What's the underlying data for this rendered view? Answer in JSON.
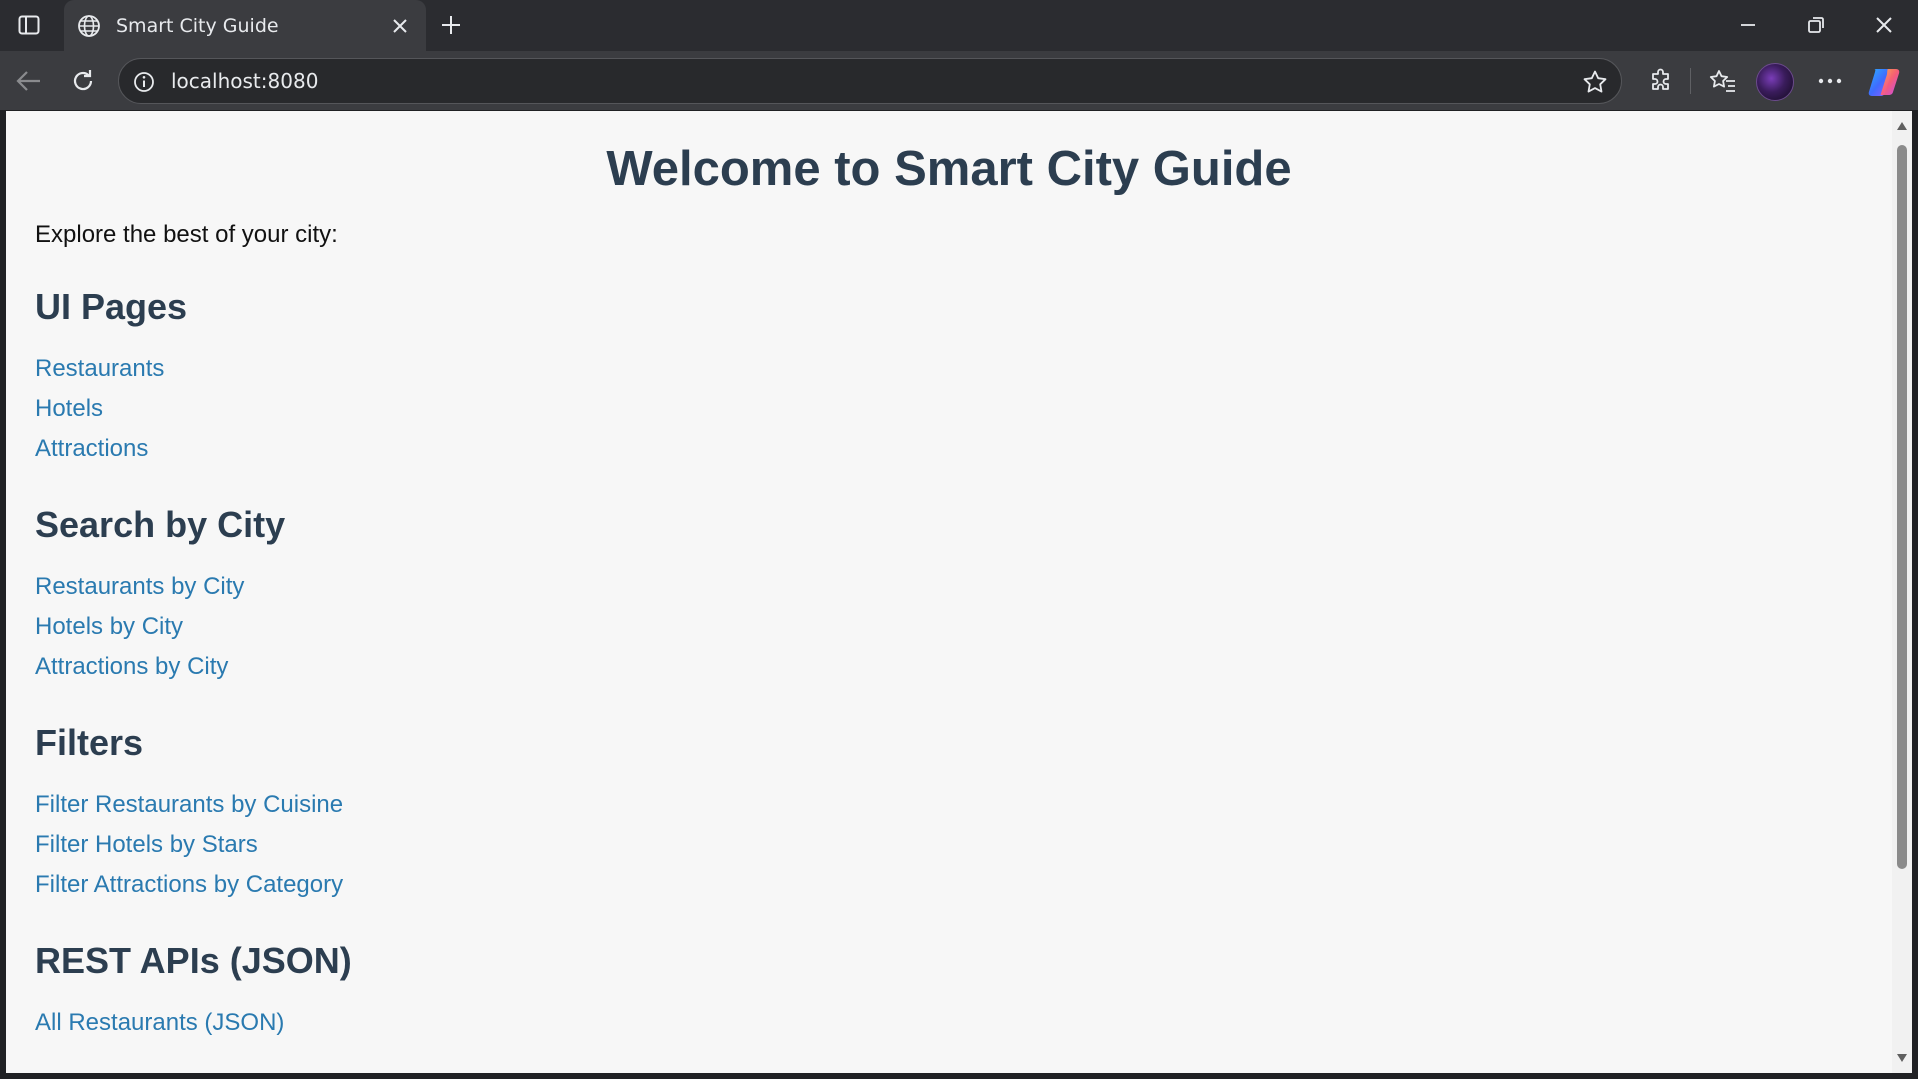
{
  "browser": {
    "tab_title": "Smart City Guide",
    "url": "localhost:8080"
  },
  "page": {
    "title": "Welcome to Smart City Guide",
    "intro": "Explore the best of your city:",
    "sections": [
      {
        "heading": "UI Pages",
        "links": [
          "Restaurants",
          "Hotels",
          "Attractions"
        ]
      },
      {
        "heading": "Search by City",
        "links": [
          "Restaurants by City",
          "Hotels by City",
          "Attractions by City"
        ]
      },
      {
        "heading": "Filters",
        "links": [
          "Filter Restaurants by Cuisine",
          "Filter Hotels by Stars",
          "Filter Attractions by Category"
        ]
      },
      {
        "heading": "REST APIs (JSON)",
        "links": [
          "All Restaurants (JSON)"
        ]
      }
    ]
  },
  "colors": {
    "heading": "#2c3e50",
    "link": "#2a7ab0",
    "page_bg": "#f7f7f7"
  }
}
